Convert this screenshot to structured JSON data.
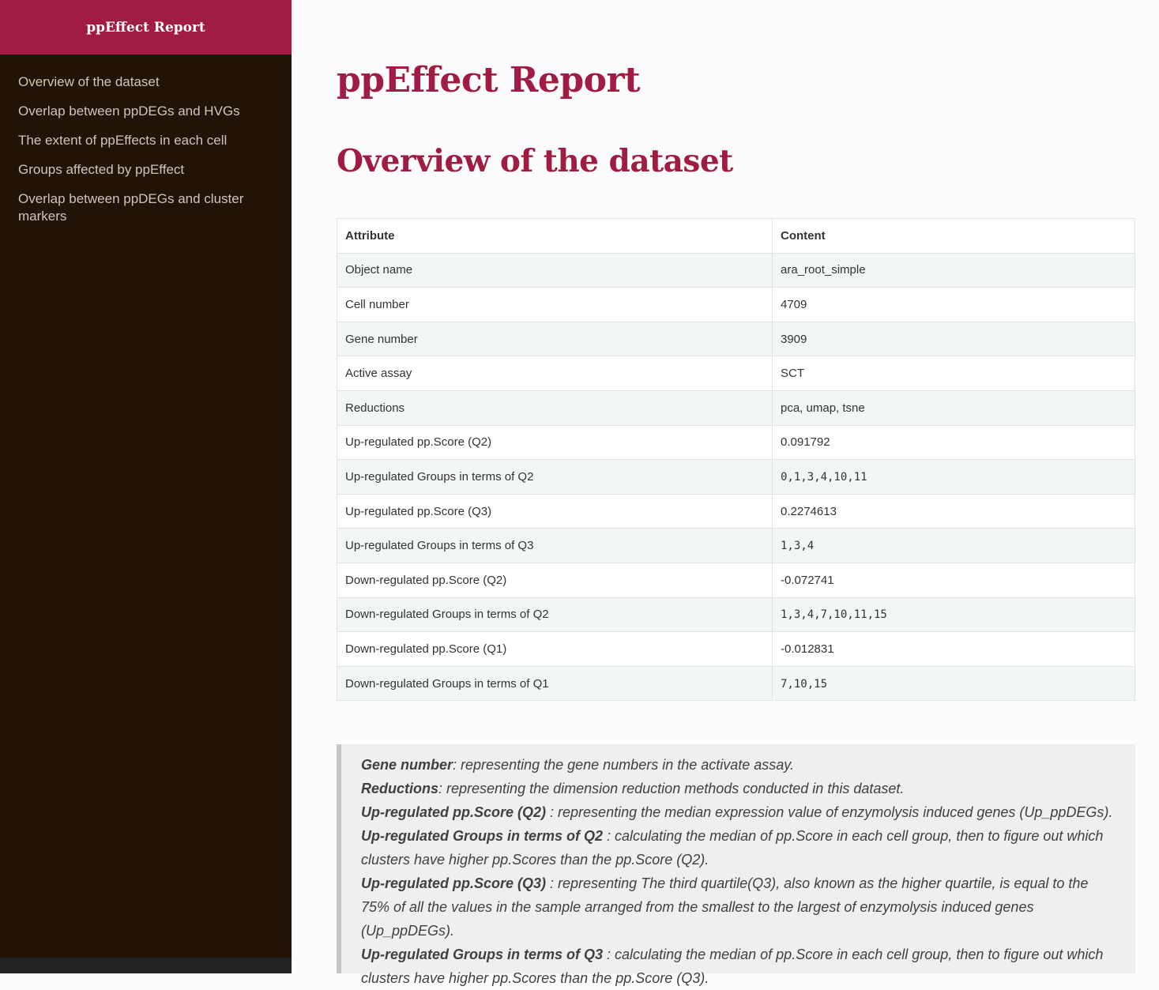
{
  "sidebar": {
    "title": "ppEffect Report",
    "items": [
      {
        "label": "Overview of the dataset"
      },
      {
        "label": "Overlap between ppDEGs and HVGs"
      },
      {
        "label": "The extent of ppEffects in each cell"
      },
      {
        "label": "Groups affected by ppEffect"
      },
      {
        "label": "Overlap between ppDEGs and cluster markers"
      }
    ]
  },
  "main": {
    "title": "ppEffect Report",
    "section_title": "Overview of the dataset",
    "table": {
      "headers": [
        "Attribute",
        "Content"
      ],
      "rows": [
        {
          "attribute": "Object name",
          "content": "ara_root_simple"
        },
        {
          "attribute": "Cell number",
          "content": "4709"
        },
        {
          "attribute": "Gene number",
          "content": "3909"
        },
        {
          "attribute": "Active assay",
          "content": "SCT"
        },
        {
          "attribute": "Reductions",
          "content": "pca, umap, tsne"
        },
        {
          "attribute": "Up-regulated pp.Score (Q2)",
          "content": "0.091792"
        },
        {
          "attribute": "Up-regulated Groups in terms of Q2",
          "content": "0,1,3,4,10,11"
        },
        {
          "attribute": "Up-regulated pp.Score (Q3)",
          "content": "0.2274613"
        },
        {
          "attribute": "Up-regulated Groups in terms of Q3",
          "content": "1,3,4"
        },
        {
          "attribute": "Down-regulated pp.Score (Q2)",
          "content": "-0.072741"
        },
        {
          "attribute": "Down-regulated Groups in terms of Q2",
          "content": "1,3,4,7,10,11,15"
        },
        {
          "attribute": "Down-regulated pp.Score (Q1)",
          "content": "-0.012831"
        },
        {
          "attribute": "Down-regulated Groups in terms of Q1",
          "content": "7,10,15"
        }
      ]
    },
    "notes": [
      {
        "term": "Gene number",
        "text": ": representing the gene numbers in the activate assay."
      },
      {
        "term": "Reductions",
        "text": ": representing the dimension reduction methods conducted in this dataset."
      },
      {
        "term": "Up-regulated pp.Score (Q2)",
        "text": " : representing the median expression value of enzymolysis induced genes (Up_ppDEGs)."
      },
      {
        "term": "Up-regulated Groups in terms of Q2",
        "text": " : calculating the median of pp.Score in each cell group, then to figure out which clusters have higher pp.Scores than the pp.Score (Q2)."
      },
      {
        "term": "Up-regulated pp.Score (Q3)",
        "text": " : representing The third quartile(Q3), also known as the higher quartile, is equal to the 75% of all the values in the sample arranged from the smallest to the largest of enzymolysis induced genes (Up_ppDEGs)."
      },
      {
        "term": "Up-regulated Groups in terms of Q3",
        "text": " : calculating the median of pp.Score in each cell group, then to figure out which clusters have higher pp.Scores than the pp.Score (Q3)."
      }
    ]
  }
}
